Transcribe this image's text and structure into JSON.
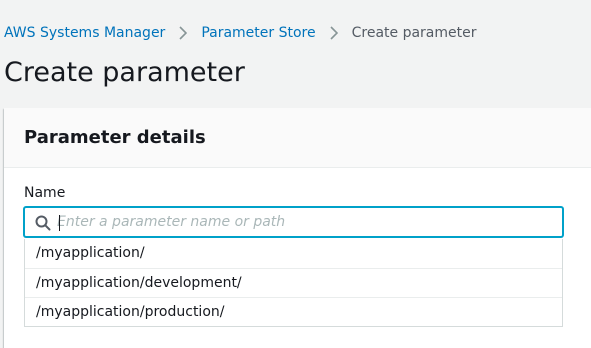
{
  "breadcrumb": {
    "items": [
      {
        "label": "AWS Systems Manager"
      },
      {
        "label": "Parameter Store"
      },
      {
        "label": "Create parameter"
      }
    ]
  },
  "page": {
    "title": "Create parameter"
  },
  "parameter_details": {
    "title": "Parameter details",
    "name_label": "Name",
    "name_input": {
      "value": "",
      "placeholder": "Enter a parameter name or path",
      "icon": "search-icon"
    },
    "suggestions": [
      "/myapplication/",
      "/myapplication/development/",
      "/myapplication/production/"
    ]
  },
  "colors": {
    "link": "#0073bb",
    "focus_border": "#00a1c9",
    "text": "#16191f",
    "muted": "#545b64",
    "background": "#f2f3f3"
  }
}
